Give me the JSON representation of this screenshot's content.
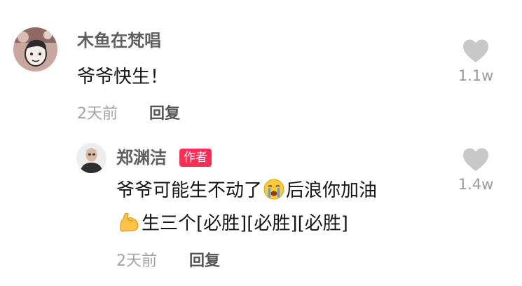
{
  "comment": {
    "username": "木鱼在梵唱",
    "text": "爷爷快生！",
    "time": "2天前",
    "reply_label": "回复",
    "like_count": "1.1w",
    "avatar_icon": "avatar-icon",
    "like_icon": "heart-icon"
  },
  "reply": {
    "username": "郑渊洁",
    "author_badge": "作者",
    "text_line1_part1": "爷爷可能生不动了",
    "text_line1_part2": "后浪你加油",
    "text_line2": "生三个[必胜][必胜][必胜]",
    "time": "2天前",
    "reply_label": "回复",
    "like_count": "1.4w",
    "emoji_1": "crying-face-emoji",
    "emoji_2": "flexed-biceps-emoji"
  },
  "colors": {
    "username": "#5f5f5f",
    "text": "#161616",
    "meta": "#a3a3a3",
    "badge": "#ff2c55",
    "heart": "#c8c8c8"
  }
}
